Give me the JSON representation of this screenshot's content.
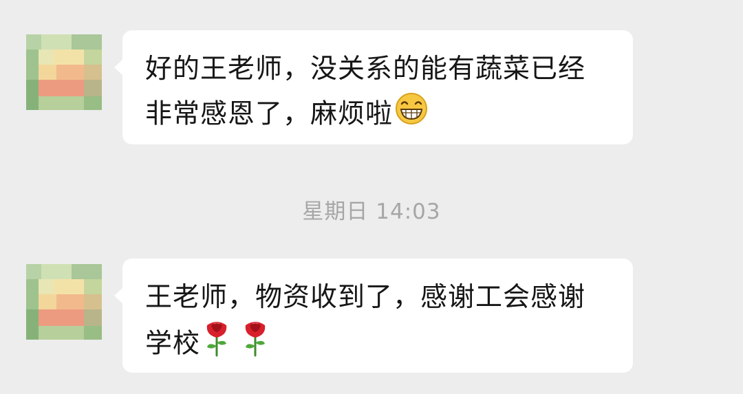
{
  "chat": {
    "messages": [
      {
        "sender": "contact",
        "text": "好的王老师，没关系的能有蔬菜已经非常感恩了，麻烦啦",
        "emoji": [
          "grinning-face-icon"
        ]
      },
      {
        "sender": "contact",
        "text": "王老师，物资收到了，感谢工会感谢学校",
        "emoji": [
          "rose-icon",
          "rose-icon"
        ]
      }
    ],
    "timestamp": "星期日 14:03"
  },
  "colors": {
    "background": "#ededed",
    "bubble": "#ffffff",
    "text": "#161616",
    "timestamp": "#a6a6a6"
  }
}
